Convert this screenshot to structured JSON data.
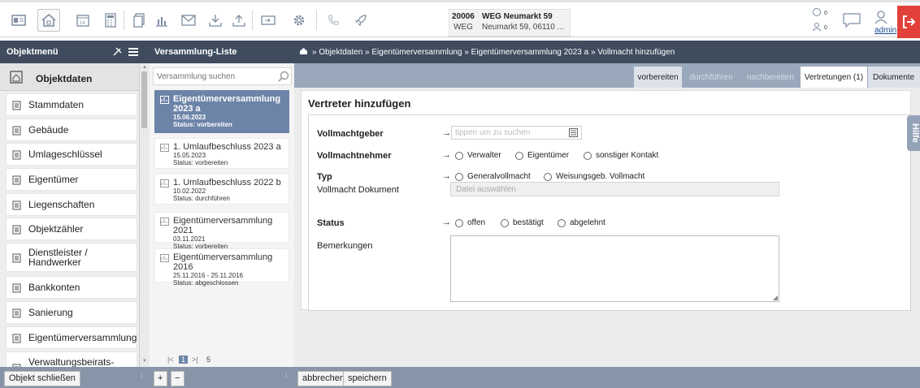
{
  "object": {
    "number": "20006",
    "type": "WEG",
    "name": "WEG Neumarkt 59",
    "address": "Neumarkt 59, 06110 ..."
  },
  "toolbar": {
    "counter1": "0",
    "counter2": "0",
    "user": "admin"
  },
  "header": {
    "objektmenu": "Objektmenü",
    "liste": "Versammlung-Liste",
    "breadcrumb": "» Objektdaten » Eigentümerversammlung » Eigentümerversammlung 2023 a » Vollmacht hinzufügen"
  },
  "sidebar": {
    "head": "Objektdaten",
    "items": [
      {
        "label": "Stammdaten"
      },
      {
        "label": "Gebäude"
      },
      {
        "label": "Umlageschlüssel"
      },
      {
        "label": "Eigentümer"
      },
      {
        "label": "Liegenschaften"
      },
      {
        "label": "Objektzähler"
      },
      {
        "label": "Dienstleister / Handwerker"
      },
      {
        "label": "Bankkonten"
      },
      {
        "label": "Sanierung"
      },
      {
        "label": "Eigentümerversammlung"
      },
      {
        "label": "Verwaltungsbeirats-"
      }
    ]
  },
  "list": {
    "search_placeholder": "Versammlung suchen",
    "items": [
      {
        "name": "Eigentümerversammlung 2023 a",
        "date": "15.06.2023",
        "status": "Status: vorbereiten"
      },
      {
        "name": "1. Umlaufbeschluss 2023 a",
        "date": "15.05.2023",
        "status": "Status: vorbereiten"
      },
      {
        "name": "1. Umlaufbeschluss 2022 b",
        "date": "10.02.2022",
        "status": "Status: durchführen"
      },
      {
        "name": "Eigentümerversammlung 2021",
        "date": "03.11.2021",
        "status": "Status: vorbereiten"
      },
      {
        "name": "Eigentümerversammlung 2016",
        "date": "25.11.2016 - 25.11.2016",
        "status": "Status: abgeschlossen"
      }
    ],
    "pager": {
      "first": "|<",
      "current": "1",
      "last": ">|",
      "count": "5"
    }
  },
  "tabs": [
    {
      "label": "vorbereiten"
    },
    {
      "label": "durchführen"
    },
    {
      "label": "nachbereiten"
    },
    {
      "label": "Vertretungen (1)"
    },
    {
      "label": "Dokumente"
    }
  ],
  "form": {
    "title": "Vertreter hinzufügen",
    "arrow": "→",
    "vollmachtgeber": {
      "label": "Vollmachtgeber",
      "placeholder": "tippen um zu suchen"
    },
    "vollmachtnehmer": {
      "label": "Vollmachtnehmer",
      "options": [
        "Verwalter",
        "Eigentümer",
        "sonstiger Kontakt"
      ]
    },
    "typ": {
      "label": "Typ",
      "options": [
        "Generalvollmacht",
        "Weisungsgeb. Vollmacht"
      ]
    },
    "dokument": {
      "label": "Vollmacht Dokument",
      "placeholder": "Datei auswählen"
    },
    "status": {
      "label": "Status",
      "options": [
        "offen",
        "bestätigt",
        "abgelehnt"
      ]
    },
    "bemerkungen": {
      "label": "Bemerkungen"
    }
  },
  "footer": {
    "close": "Objekt schließen",
    "plus": "+",
    "minus": "−",
    "abbrechen": "abbrechen",
    "speichern": "speichern"
  },
  "help": "Hilfe",
  "colors": {
    "header": "#3f4c5e",
    "selected": "#6c84a7",
    "logout": "#e2403a",
    "tabsbar": "#9aa8bc"
  }
}
